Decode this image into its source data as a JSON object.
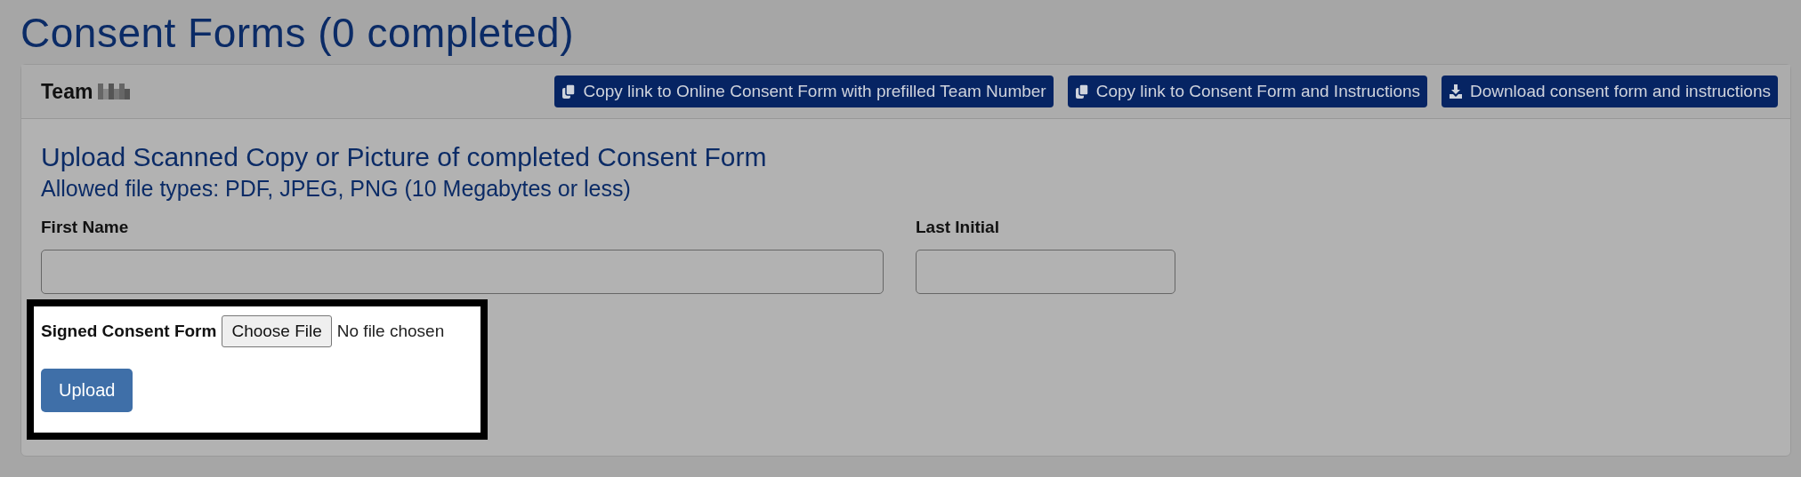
{
  "title": "Consent Forms (0 completed)",
  "card": {
    "team_label": "Team",
    "actions": [
      {
        "label": "Copy link to Online Consent Form with prefilled Team Number",
        "kind": "copy"
      },
      {
        "label": "Copy link to Consent Form and Instructions",
        "kind": "copy"
      },
      {
        "label": "Download consent form and instructions",
        "kind": "download"
      }
    ],
    "heading": "Upload Scanned Copy or Picture of completed Consent Form",
    "subheading": "Allowed file types: PDF, JPEG, PNG (10 Megabytes or less)",
    "fields": [
      {
        "label": "First Name",
        "kind": "wide"
      },
      {
        "label": "Last Initial",
        "kind": "narrow"
      }
    ],
    "file_input": {
      "label": "Signed Consent Form",
      "button": "Choose File",
      "status": "No file chosen"
    },
    "submit": "Upload"
  }
}
